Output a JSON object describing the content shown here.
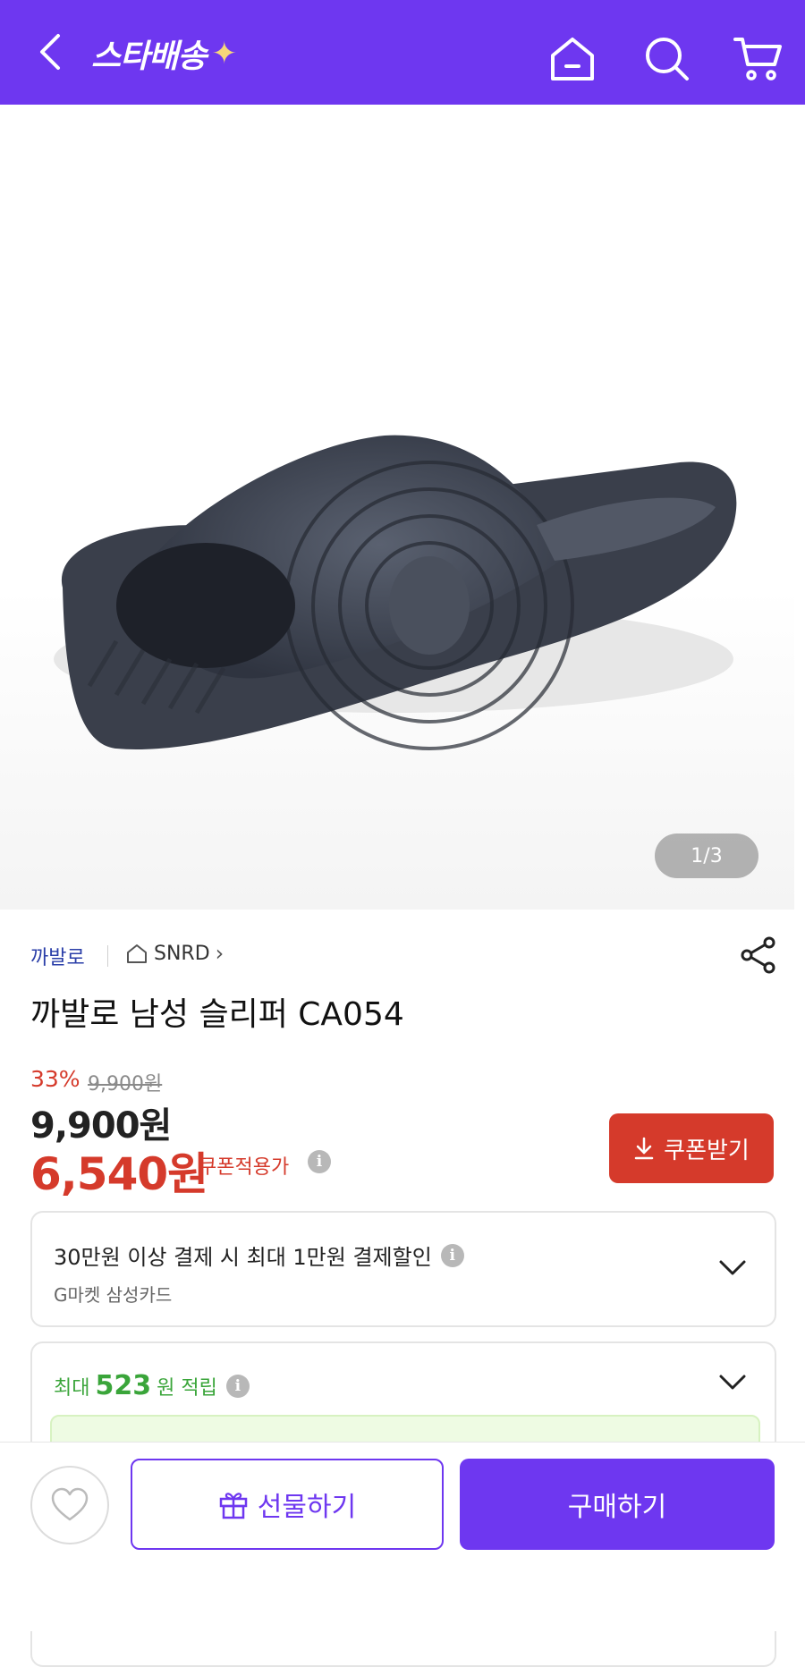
{
  "header": {
    "brand": "스타배송",
    "brand_star": "✦",
    "accent_color": "#6e37f0"
  },
  "gallery": {
    "counter": "1/3"
  },
  "product": {
    "brand": "까발로",
    "store": "SNRD",
    "store_arrow": "›",
    "title": "까발로 남성 슬리퍼 CA054",
    "discount": "33%",
    "original_price": "9,900원",
    "price": "9,900원",
    "coupon_price": "6,540원",
    "coupon_price_label": "쿠폰적용가",
    "coupon_button": "쿠폰받기"
  },
  "card_offer": {
    "title": "30만원 이상 결제 시 최대 1만원 결제할인",
    "subtitle": "G마켓 삼성카드"
  },
  "points": {
    "prefix": "최대",
    "amount": "523",
    "suffix": "원 적립"
  },
  "bottom": {
    "gift_label": "선물하기",
    "buy_label": "구매하기"
  },
  "colors": {
    "purple": "#6e37f0",
    "red": "#d53a2b",
    "green": "#3aa53a"
  },
  "icons": [
    "back-arrow-icon",
    "home-icon",
    "search-icon",
    "cart-icon",
    "share-icon",
    "info-icon",
    "download-icon",
    "chevron-down-icon",
    "heart-icon",
    "gift-icon",
    "store-home-icon"
  ]
}
